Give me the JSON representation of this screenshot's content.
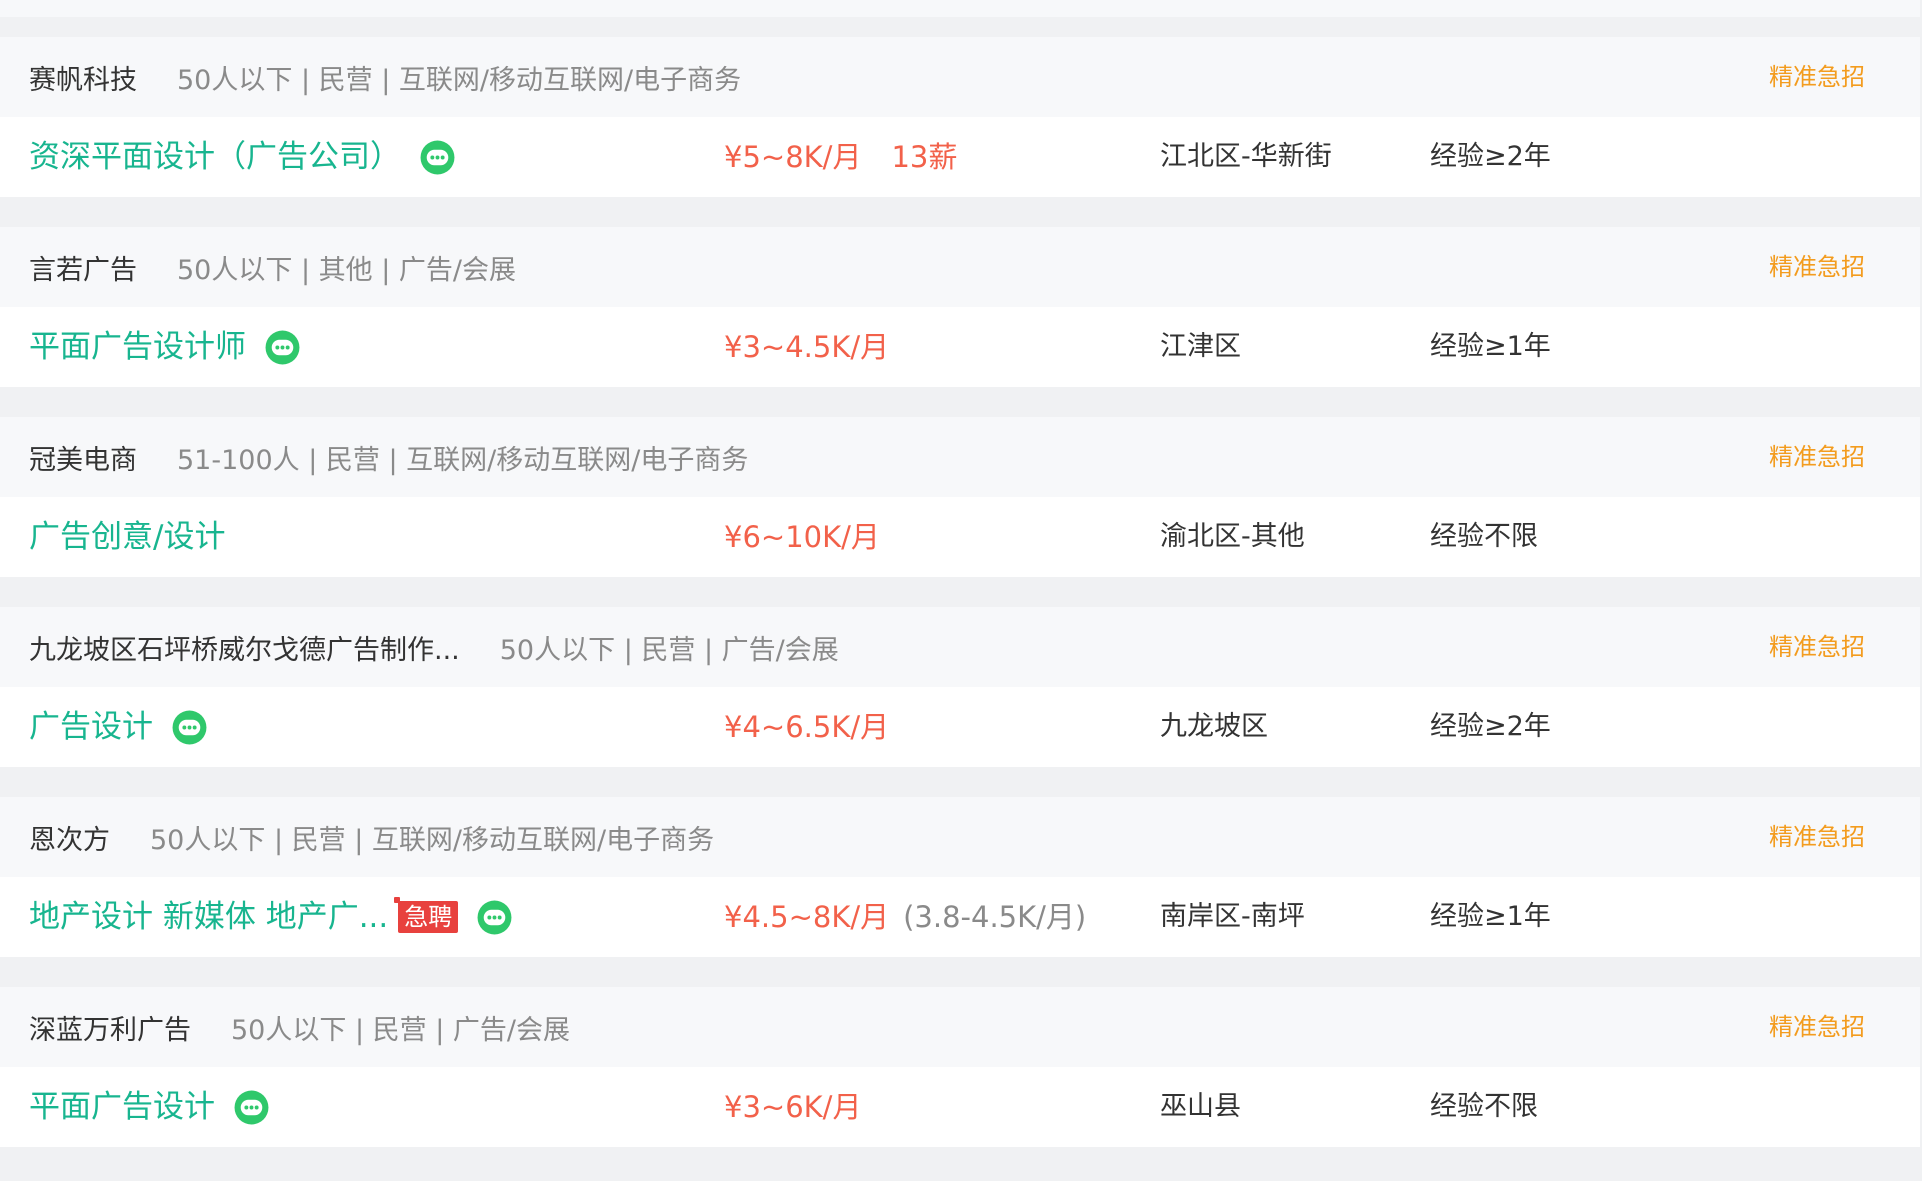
{
  "colors": {
    "accent_green": "#18b58f",
    "salary_red": "#f2614a",
    "urgent_orange": "#f39c1f",
    "badge_red": "#e8413e"
  },
  "icons": {
    "chat": "chat-bubble-icon"
  },
  "jobs": [
    {
      "company": "赛帆科技",
      "company_info": "50人以下 | 民营 | 互联网/移动互联网/电子商务",
      "tag": "精准急招",
      "title": "资深平面设计（广告公司）",
      "badge": "",
      "chat": true,
      "salary": "¥5~8K/月",
      "salary_extra": "13薪",
      "salary_sub": "",
      "location": "江北区-华新街",
      "experience": "经验≥2年"
    },
    {
      "company": "言若广告",
      "company_info": "50人以下 | 其他 | 广告/会展",
      "tag": "精准急招",
      "title": "平面广告设计师",
      "badge": "",
      "chat": true,
      "salary": "¥3~4.5K/月",
      "salary_extra": "",
      "salary_sub": "",
      "location": "江津区",
      "experience": "经验≥1年"
    },
    {
      "company": "冠美电商",
      "company_info": "51-100人 | 民营 | 互联网/移动互联网/电子商务",
      "tag": "精准急招",
      "title": "广告创意/设计",
      "badge": "",
      "chat": false,
      "salary": "¥6~10K/月",
      "salary_extra": "",
      "salary_sub": "",
      "location": "渝北区-其他",
      "experience": "经验不限"
    },
    {
      "company": "九龙坡区石坪桥威尔戈德广告制作...",
      "company_info": "50人以下 | 民营 | 广告/会展",
      "tag": "精准急招",
      "title": "广告设计",
      "badge": "",
      "chat": true,
      "salary": "¥4~6.5K/月",
      "salary_extra": "",
      "salary_sub": "",
      "location": "九龙坡区",
      "experience": "经验≥2年"
    },
    {
      "company": "恩次方",
      "company_info": "50人以下 | 民营 | 互联网/移动互联网/电子商务",
      "tag": "精准急招",
      "title": "地产设计 新媒体 地产广...",
      "badge": "急聘",
      "chat": true,
      "salary": "¥4.5~8K/月",
      "salary_extra": "",
      "salary_sub": "(3.8-4.5K/月)",
      "location": "南岸区-南坪",
      "experience": "经验≥1年"
    },
    {
      "company": "深蓝万利广告",
      "company_info": "50人以下 | 民营 | 广告/会展",
      "tag": "精准急招",
      "title": "平面广告设计",
      "badge": "",
      "chat": true,
      "salary": "¥3~6K/月",
      "salary_extra": "",
      "salary_sub": "",
      "location": "巫山县",
      "experience": "经验不限"
    }
  ]
}
